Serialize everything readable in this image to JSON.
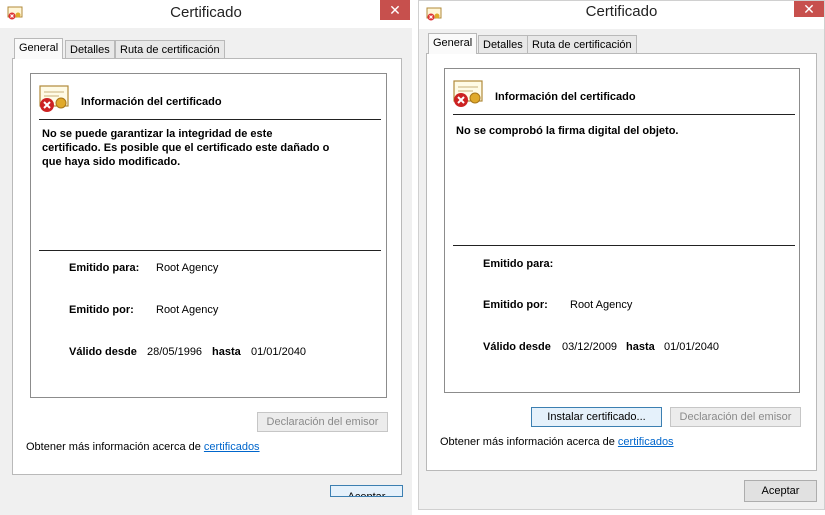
{
  "left_dialog": {
    "title": "Certificado",
    "close_glyph": "✕",
    "tabs": [
      "General",
      "Detalles",
      "Ruta de certificación"
    ],
    "info_heading": "Información del certificado",
    "message_lines": [
      "No se puede garantizar la integridad de este",
      "certificado. Es posible que el certificado este dañado o",
      "que haya sido modificado."
    ],
    "issued_to_label": "Emitido para:",
    "issued_to_value": "Root Agency",
    "issued_by_label": "Emitido por:",
    "issued_by_value": "Root Agency",
    "valid_from_label": "Válido desde",
    "valid_from_value": "28/05/1996",
    "valid_to_label": "hasta",
    "valid_to_value": "01/01/2040",
    "issuer_statement_button": "Declaración del emisor",
    "more_info_text": "Obtener más información acerca de ",
    "more_info_link": "certificados",
    "ok_button": "Aceptar"
  },
  "right_dialog": {
    "title": "Certificado",
    "close_glyph": "✕",
    "tabs": [
      "General",
      "Detalles",
      "Ruta de certificación"
    ],
    "info_heading": "Información del certificado",
    "message_lines": [
      "No se comprobó la firma digital del objeto."
    ],
    "issued_to_label": "Emitido para:",
    "issued_by_label": "Emitido por:",
    "issued_by_value": "Root Agency",
    "valid_from_label": "Válido desde",
    "valid_from_value": "03/12/2009",
    "valid_to_label": "hasta",
    "valid_to_value": "01/01/2040",
    "install_button": "Instalar certificado...",
    "issuer_statement_button": "Declaración del emisor",
    "more_info_text": "Obtener más información acerca de ",
    "more_info_link": "certificados",
    "ok_button": "Aceptar"
  },
  "icons": {
    "title": "certificate-icon",
    "cert": "certificate-error-icon",
    "close": "close-icon"
  },
  "colors": {
    "close_button": "#c7504d",
    "link": "#0066cc",
    "error_badge": "#cc2222"
  }
}
